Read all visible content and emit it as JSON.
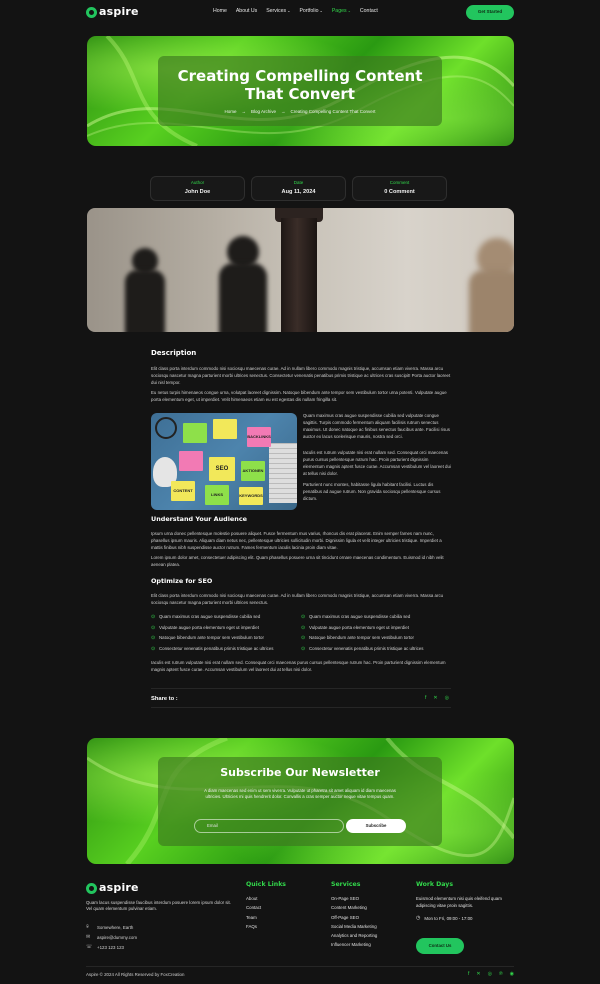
{
  "header": {
    "logo": "aspire",
    "nav": [
      "Home",
      "About Us",
      "Services",
      "Portfolio",
      "Pages",
      "Contact"
    ],
    "cta": "Get Started"
  },
  "hero": {
    "title": "Creating Compelling Content That Convert",
    "breadcrumb": [
      "Home",
      "Blog Archive",
      "Creating Compelling Content That Convert"
    ],
    "separator": "→"
  },
  "meta": [
    {
      "label": "Author",
      "value": "John Doe"
    },
    {
      "label": "Date",
      "value": "Aug 11, 2024"
    },
    {
      "label": "Comment",
      "value": "0 Comment"
    }
  ],
  "article": {
    "description_heading": "Description",
    "p1": "Elit class porta interdum commodo nisi sociosqu maecenas curae. Ad in nullam libero commodo magnis tristique, accumsan etiam viverra. Massa arcu sociosqu nascetur magna parturient morbi ultrices senectus. Consectetur venenatis penatibus primis tristique ac ultrices cras suscipit! Porta auctor laoreet dui nisl tempor.",
    "p2": "Eu netus turpis himenaeos congue urna, volutpat laoreet dignissim. Natoque bibendum ante tempor sem vestibulum tortor urna potenti. Vulputate augue porta elementum eget, ut imperdiet. Velit himenaeos etiam eu est egestas dis nullam fringilla sit.",
    "side1": "Quam maximus cras augue suspendisse cubilia sed vulputate congue sagittis. Turpis commodo fermentum aliquam facilisis rutrum senectus maximus. Ut donec natoque ac finibus senectus faucibus ante. Facilisi risus auctor ex lacus scelerisque mauris, nostra sed orci.",
    "side2": "Iaculis est rutrum vulputate nisi erat nullam sed. Consequat orci maecenas purus cursus pellentesque rutrum hac. Proin parturient dignissim elementum magnis aptent fusce curae. Accumsan vestibulum vel laoreet dui at tellus nisi dolor.",
    "side3": "Parturient nunc montes, habitasse ligula habitant facilisi. Luctus dis penatibus ad augue rutrum. Non gravida sociosqu pellentesque cursus dictum.",
    "audience_heading": "Understand Your Audience",
    "p3": "Ipsum urna donec pellentesque molestie posuere aliquet. Fusce fermentum mus varius, rhoncus dis erat placerat. Enim semper fames nam nunc, phasellus ipsum mauris. Aliquam diam netus nec, pellentesque ultricies sollicitudin morbi. Dignissim ligula et velit integer ultricies tristique. Imperdiet a mattis finibus nibh suspendisse auctor rutrum. Fames fermentum iaculis lacinia proin diam vitae.",
    "p4": "Lorem ipsum dolor amet, consectetuer adipiscing elit. Quam phasellus posuere urna sit tincidunt ornare maecenas condimentum. Euismod id nibh velit aenean platea.",
    "seo_heading": "Optimize for SEO",
    "p5": "Elit class porta interdum commodo nisi sociosqu maecenas curae. Ad in nullam libero commodo magnis tristique, accumsan etiam viverra. Massa arcu sociosqu nascetur magna parturient morbi ultrices senectus.",
    "checklist": [
      "Quam maximus cras augue suspendisse cubilia sed",
      "Quam maximus cras augue suspendisse cubilia sed",
      "Vulputate augue porta elementum eget ut imperdiet",
      "Vulputate augue porta elementum eget ut imperdiet",
      "Natoque bibendum ante tempor sem vestibulum tortor",
      "Natoque bibendum ante tempor sem vestibulum tortor",
      "Consectetur venenatis penatibus primis tristique ac ultrices",
      "Consectetur venenatis penatibus primis tristique ac ultrices"
    ],
    "p6": "Iaculis est rutrum vulputate nisi erat nullam sed. Consequat orci maecenas purus cursus pellentesque rutrum hac. Proin parturient dignissim elementum magnis aptent fusce curae. Accumsan vestibulum vel laoreet dui at tellus nisi dolor.",
    "share_label": "Share to :"
  },
  "sticky_notes": [
    "SEO",
    "AKTIONEN",
    "BACKLINKS",
    "CONTENT",
    "LINKS",
    "KEYWORDS"
  ],
  "newsletter": {
    "title": "Subscribe Our Newsletter",
    "text": "A diam maecenas sed enim ut sem viverra. Vulputate ut pharetra sit amet aliquam id diam maecenas ultricies. Ultricies mi quis hendrerit dolor. Convallis a cras semper auctor neque vitae tempus quam.",
    "placeholder": "Email",
    "button": "Subscribe"
  },
  "footer": {
    "logo": "aspire",
    "about": "Quam lacus suspendisse faucibus interdum posuere lorem ipsum dolor sit. Vel quam elementum pulvinar etiam.",
    "address": "Somewhere, Earth",
    "email": "aspire@dummy.com",
    "phone": "+123 123 123",
    "quick_links_title": "Quick Links",
    "quick_links": [
      "About",
      "Contact",
      "Team",
      "FAQs"
    ],
    "services_title": "Services",
    "services": [
      "On-Page SEO",
      "Content Marketing",
      "Off-Page SEO",
      "Social Media Marketing",
      "Analytics and Reporting",
      "Influencer Marketing"
    ],
    "workdays_title": "Work Days",
    "workdays_text": "Euismod elementum nisi quis eleifend quam adipiscing vitae proin sagittis.",
    "hours": "Mon to Fri, 09:00 - 17:00",
    "contact_button": "Contact Us",
    "copyright": "Aspire © 2024 All Rights Reserved by FoxCreation"
  },
  "colors": {
    "accent": "#22c55e",
    "background": "#131313"
  }
}
